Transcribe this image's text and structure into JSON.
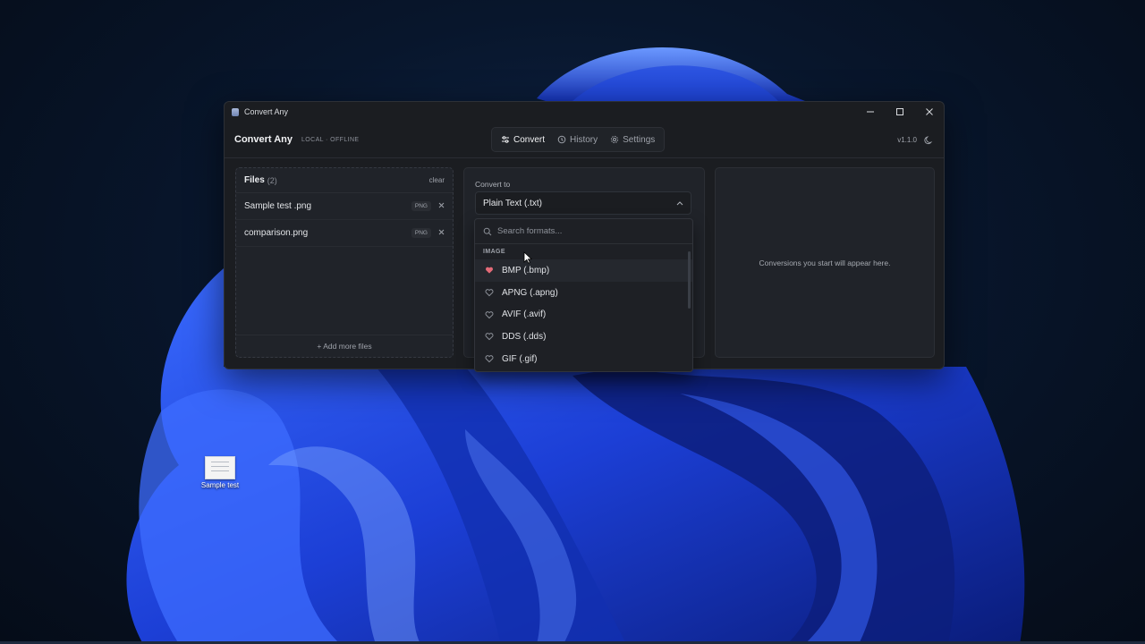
{
  "window": {
    "title": "Convert Any"
  },
  "header": {
    "brand": "Convert Any",
    "brand_sub": "LOCAL · OFFLINE",
    "tabs": [
      {
        "label": "Convert",
        "icon": "sliders-icon",
        "active": true
      },
      {
        "label": "History",
        "icon": "history-icon",
        "active": false
      },
      {
        "label": "Settings",
        "icon": "gear-icon",
        "active": false
      }
    ],
    "version": "v1.1.0"
  },
  "files": {
    "title": "Files",
    "count": "(2)",
    "clear_label": "clear",
    "items": [
      {
        "name": "Sample test .png",
        "type": "PNG"
      },
      {
        "name": "comparison.png",
        "type": "PNG"
      }
    ],
    "add_more_label": "+ Add more files"
  },
  "convert": {
    "label": "Convert to",
    "selected": "Plain Text (.txt)",
    "search_placeholder": "Search formats...",
    "group_label": "IMAGE",
    "options": [
      {
        "label": "BMP (.bmp)",
        "favorite": true
      },
      {
        "label": "APNG (.apng)",
        "favorite": false
      },
      {
        "label": "AVIF (.avif)",
        "favorite": false
      },
      {
        "label": "DDS (.dds)",
        "favorite": false
      },
      {
        "label": "GIF (.gif)",
        "favorite": false
      }
    ]
  },
  "results": {
    "empty_text": "Conversions you start will appear here."
  },
  "desktop": {
    "icon_label": "Sample test"
  },
  "colors": {
    "accent_favorite": "#e46b78",
    "window_bg": "#1b1d21",
    "panel_bg": "#202329"
  }
}
